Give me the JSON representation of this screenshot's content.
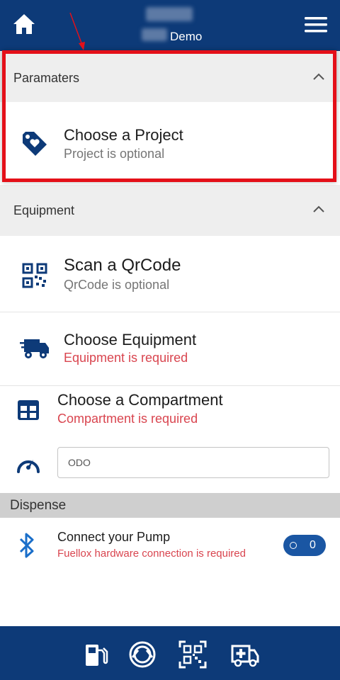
{
  "header": {
    "title": "Demo",
    "icons": {
      "home": "home-icon",
      "menu": "hamburger-menu-icon"
    }
  },
  "sections": {
    "parameters": {
      "label": "Paramaters"
    },
    "equipment": {
      "label": "Equipment"
    },
    "dispense": {
      "label": "Dispense"
    }
  },
  "project": {
    "title": "Choose a Project",
    "subtitle": "Project is optional",
    "icon": "tag-heart-icon"
  },
  "qrcode": {
    "title": "Scan a QrCode",
    "subtitle": "QrCode is optional",
    "icon": "qr-code-icon"
  },
  "equipment_row": {
    "title": "Choose Equipment",
    "subtitle": "Equipment is required",
    "icon": "truck-icon"
  },
  "compartment": {
    "title": "Choose a Compartment",
    "subtitle": "Compartment is required",
    "icon": "grid-table-icon"
  },
  "odo": {
    "placeholder": "ODO",
    "icon": "speedometer-icon"
  },
  "pump": {
    "title": "Connect your Pump",
    "subtitle": "Fuellox hardware connection is required",
    "icon": "bluetooth-icon",
    "toggle_count": "0"
  },
  "bottom_nav": [
    "fuel-pump-icon",
    "pump-ring-icon",
    "qr-scan-icon",
    "ambulance-icon"
  ],
  "colors": {
    "brand": "#0d3a78",
    "required": "#d9454f",
    "toggle": "#1a56a3",
    "highlight": "#e41019"
  }
}
